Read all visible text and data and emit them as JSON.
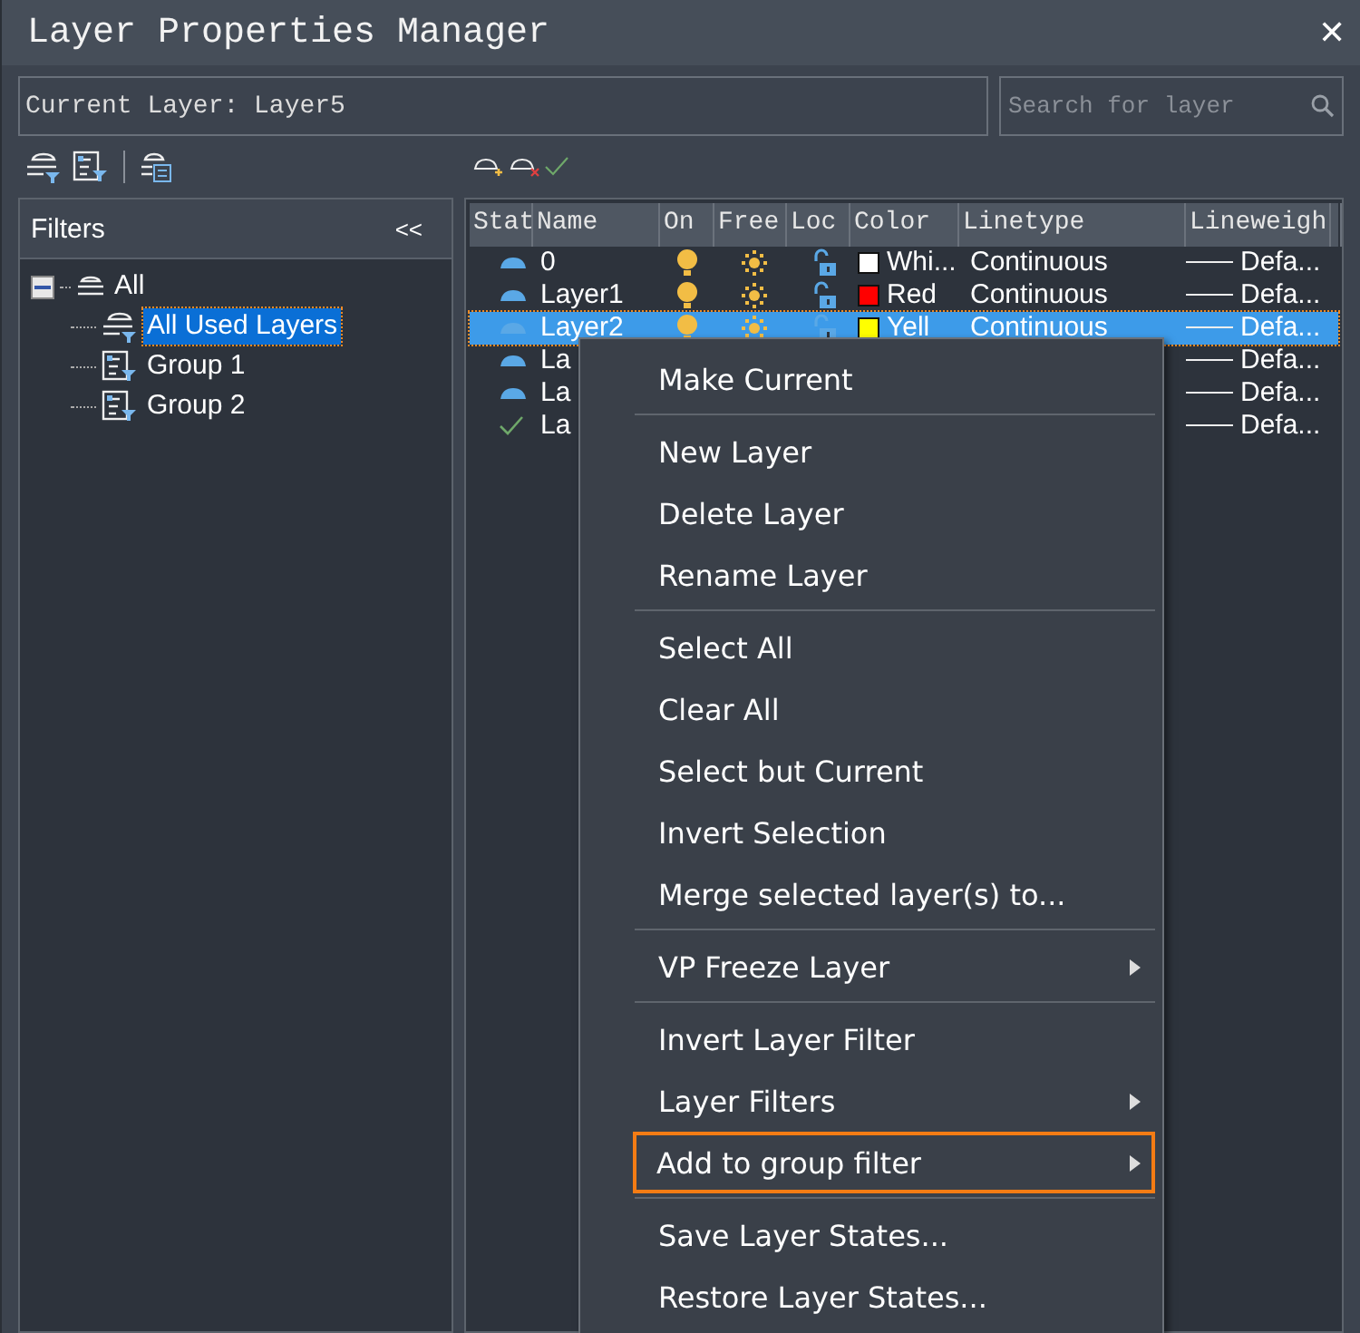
{
  "window": {
    "title": "Layer Properties Manager",
    "close": "✕"
  },
  "current_layer": {
    "value": "Current Layer: Layer5"
  },
  "search": {
    "placeholder": "Search for layer"
  },
  "filters": {
    "title": "Filters",
    "collapse": "<<",
    "tree": [
      {
        "label": "All",
        "expanded": true,
        "selected": false,
        "kind": "all",
        "children": [
          {
            "label": "All Used Layers",
            "selected": true,
            "kind": "filter"
          },
          {
            "label": "Group 1",
            "selected": false,
            "kind": "group"
          },
          {
            "label": "Group 2",
            "selected": false,
            "kind": "group"
          }
        ]
      }
    ]
  },
  "table": {
    "columns": [
      "Stat",
      "Name",
      "On",
      "Free",
      "Loc",
      "Color",
      "Linetype",
      "Lineweigh"
    ],
    "rows": [
      {
        "kind": "layer",
        "name": "0",
        "on": true,
        "frozen": false,
        "locked": false,
        "color": "#ffffff",
        "color_name": "Whi...",
        "linetype": "Continuous",
        "lineweight": "Defa...",
        "selected": false
      },
      {
        "kind": "layer",
        "name": "Layer1",
        "on": true,
        "frozen": false,
        "locked": false,
        "color": "#ff0000",
        "color_name": "Red",
        "linetype": "Continuous",
        "lineweight": "Defa...",
        "selected": false
      },
      {
        "kind": "layer",
        "name": "Layer2",
        "on": true,
        "frozen": false,
        "locked": false,
        "color": "#ffff00",
        "color_name": "Yell",
        "linetype": "Continuous",
        "lineweight": "Defa...",
        "selected": true
      },
      {
        "kind": "layer",
        "name": "La",
        "lineweight": "Defa...",
        "selected": false
      },
      {
        "kind": "layer",
        "name": "La",
        "lineweight": "Defa...",
        "selected": false
      },
      {
        "kind": "current",
        "name": "La",
        "lineweight": "Defa...",
        "selected": false
      }
    ]
  },
  "context_menu": {
    "groups": [
      [
        {
          "label": "Make Current",
          "submenu": false,
          "highlighted": false
        }
      ],
      [
        {
          "label": "New Layer",
          "submenu": false,
          "highlighted": false
        },
        {
          "label": "Delete Layer",
          "submenu": false,
          "highlighted": false
        },
        {
          "label": "Rename Layer",
          "submenu": false,
          "highlighted": false
        }
      ],
      [
        {
          "label": "Select All",
          "submenu": false,
          "highlighted": false
        },
        {
          "label": "Clear All",
          "submenu": false,
          "highlighted": false
        },
        {
          "label": "Select but Current",
          "submenu": false,
          "highlighted": false
        },
        {
          "label": "Invert Selection",
          "submenu": false,
          "highlighted": false
        },
        {
          "label": "Merge selected layer(s) to...",
          "submenu": false,
          "highlighted": false
        }
      ],
      [
        {
          "label": "VP Freeze Layer",
          "submenu": true,
          "highlighted": false
        }
      ],
      [
        {
          "label": "Invert Layer Filter",
          "submenu": false,
          "highlighted": false
        },
        {
          "label": "Layer Filters",
          "submenu": true,
          "highlighted": false
        },
        {
          "label": "Add to group filter",
          "submenu": true,
          "highlighted": true
        }
      ],
      [
        {
          "label": "Save Layer States...",
          "submenu": false,
          "highlighted": false
        },
        {
          "label": "Restore Layer States...",
          "submenu": false,
          "highlighted": false
        }
      ]
    ]
  }
}
